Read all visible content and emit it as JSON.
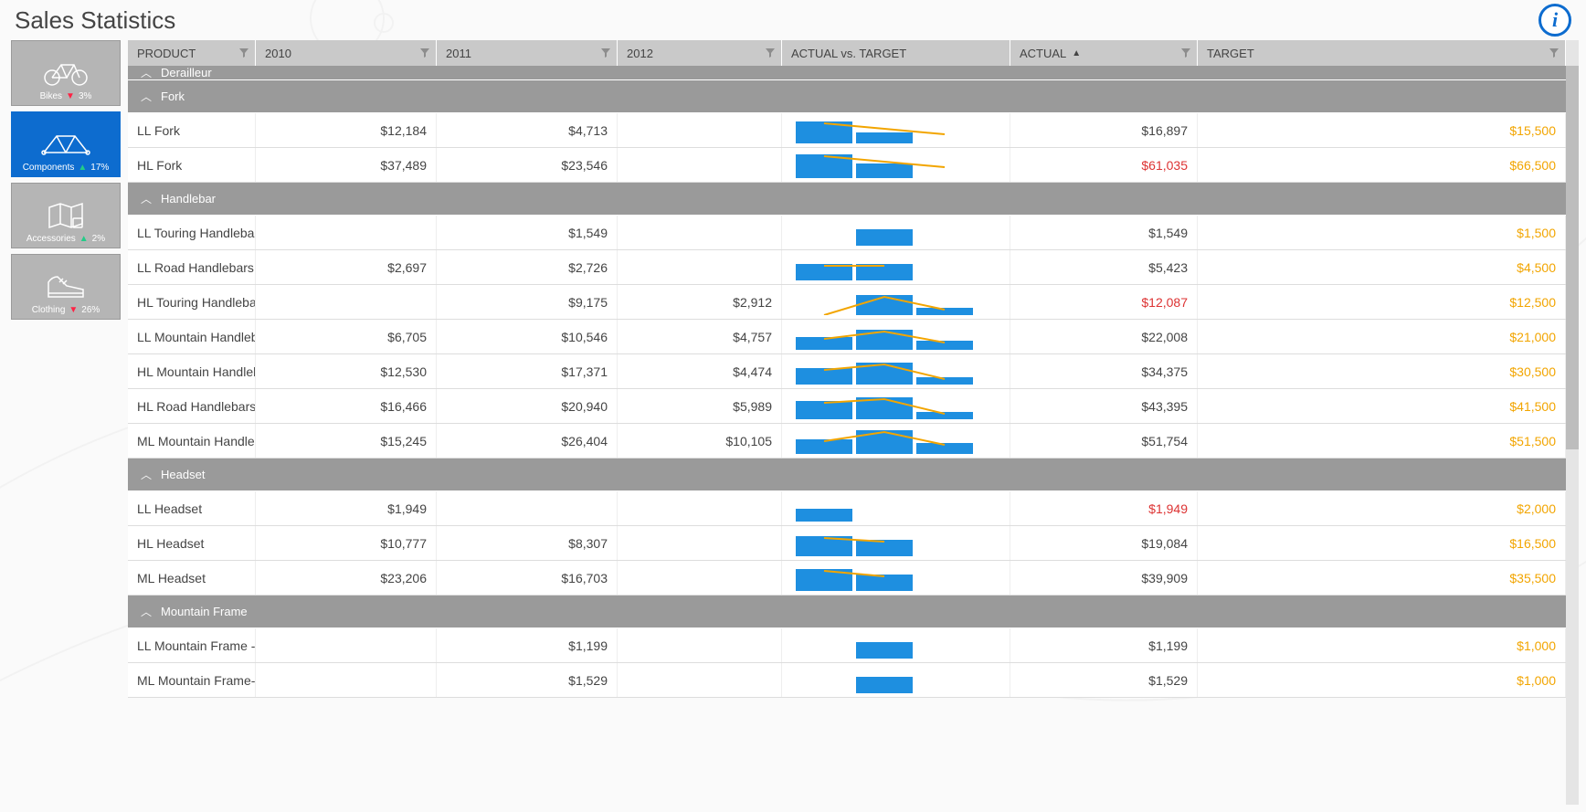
{
  "page": {
    "title": "Sales Statistics"
  },
  "sidebar": {
    "tiles": [
      {
        "label": "Bikes",
        "delta": "3%",
        "trend": "down",
        "icon": "bike",
        "active": false
      },
      {
        "label": "Components",
        "delta": "17%",
        "trend": "up",
        "icon": "frame",
        "active": true
      },
      {
        "label": "Accessories",
        "delta": "2%",
        "trend": "up",
        "icon": "map",
        "active": false
      },
      {
        "label": "Clothing",
        "delta": "26%",
        "trend": "down",
        "icon": "shoe",
        "active": false
      }
    ]
  },
  "columns": {
    "product": "PRODUCT",
    "y2010": "2010",
    "y2011": "2011",
    "y2012": "2012",
    "avt": "ACTUAL vs. TARGET",
    "actual": "ACTUAL",
    "target": "TARGET"
  },
  "groups": [
    {
      "name": "Derailleur",
      "collapsedHeader": true,
      "rows": []
    },
    {
      "name": "Fork",
      "rows": [
        {
          "product": "LL Fork",
          "y2010": "$12,184",
          "y2011": "$4,713",
          "y2012": "",
          "actual": "$16,897",
          "target": "$15,500",
          "spark": [
            24,
            12,
            0
          ],
          "line": [
            22,
            16,
            10
          ],
          "red": false
        },
        {
          "product": "HL Fork",
          "y2010": "$37,489",
          "y2011": "$23,546",
          "y2012": "",
          "actual": "$61,035",
          "target": "$66,500",
          "spark": [
            26,
            16,
            0
          ],
          "line": [
            24,
            18,
            12
          ],
          "red": true
        }
      ]
    },
    {
      "name": "Handlebar",
      "rows": [
        {
          "product": "LL Touring Handlebar",
          "y2010": "",
          "y2011": "$1,549",
          "y2012": "",
          "actual": "$1,549",
          "target": "$1,500",
          "spark": [
            0,
            18,
            0
          ],
          "line": [],
          "red": false
        },
        {
          "product": "LL Road Handlebars",
          "y2010": "$2,697",
          "y2011": "$2,726",
          "y2012": "",
          "actual": "$5,423",
          "target": "$4,500",
          "spark": [
            18,
            18,
            0
          ],
          "line": [
            16,
            16
          ],
          "red": false
        },
        {
          "product": "HL Touring Handlebar",
          "y2010": "",
          "y2011": "$9,175",
          "y2012": "$2,912",
          "actual": "$12,087",
          "target": "$12,500",
          "spark": [
            0,
            22,
            8
          ],
          "line": [
            0,
            20,
            6
          ],
          "red": true
        },
        {
          "product": "LL Mountain Handleb",
          "y2010": "$6,705",
          "y2011": "$10,546",
          "y2012": "$4,757",
          "actual": "$22,008",
          "target": "$21,000",
          "spark": [
            14,
            22,
            10
          ],
          "line": [
            12,
            20,
            8
          ],
          "red": false
        },
        {
          "product": "HL Mountain Handleb",
          "y2010": "$12,530",
          "y2011": "$17,371",
          "y2012": "$4,474",
          "actual": "$34,375",
          "target": "$30,500",
          "spark": [
            18,
            24,
            8
          ],
          "line": [
            16,
            22,
            6
          ],
          "red": false
        },
        {
          "product": "HL Road Handlebars",
          "y2010": "$16,466",
          "y2011": "$20,940",
          "y2012": "$5,989",
          "actual": "$43,395",
          "target": "$41,500",
          "spark": [
            20,
            24,
            8
          ],
          "line": [
            18,
            22,
            6
          ],
          "red": false
        },
        {
          "product": "ML Mountain Handle",
          "y2010": "$15,245",
          "y2011": "$26,404",
          "y2012": "$10,105",
          "actual": "$51,754",
          "target": "$51,500",
          "spark": [
            16,
            26,
            12
          ],
          "line": [
            14,
            24,
            10
          ],
          "red": false
        }
      ]
    },
    {
      "name": "Headset",
      "rows": [
        {
          "product": "LL Headset",
          "y2010": "$1,949",
          "y2011": "",
          "y2012": "",
          "actual": "$1,949",
          "target": "$2,000",
          "spark": [
            14,
            0,
            0
          ],
          "line": [],
          "red": true
        },
        {
          "product": "HL Headset",
          "y2010": "$10,777",
          "y2011": "$8,307",
          "y2012": "",
          "actual": "$19,084",
          "target": "$16,500",
          "spark": [
            22,
            18,
            0
          ],
          "line": [
            20,
            16
          ],
          "red": false
        },
        {
          "product": "ML Headset",
          "y2010": "$23,206",
          "y2011": "$16,703",
          "y2012": "",
          "actual": "$39,909",
          "target": "$35,500",
          "spark": [
            24,
            18,
            0
          ],
          "line": [
            22,
            16
          ],
          "red": false
        }
      ]
    },
    {
      "name": "Mountain Frame",
      "rows": [
        {
          "product": "LL Mountain Frame -",
          "y2010": "",
          "y2011": "$1,199",
          "y2012": "",
          "actual": "$1,199",
          "target": "$1,000",
          "spark": [
            0,
            18,
            0
          ],
          "line": [],
          "red": false
        },
        {
          "product": "ML Mountain Frame-",
          "y2010": "",
          "y2011": "$1,529",
          "y2012": "",
          "actual": "$1,529",
          "target": "$1,000",
          "spark": [
            0,
            18,
            0
          ],
          "line": [],
          "red": false
        }
      ]
    }
  ],
  "chart_data": {
    "type": "table",
    "title": "Sales Statistics — Components",
    "columns": [
      "Product",
      "2010",
      "2011",
      "2012",
      "Actual",
      "Target"
    ],
    "series": [
      {
        "name": "LL Fork",
        "values": [
          12184,
          4713,
          null,
          16897,
          15500
        ]
      },
      {
        "name": "HL Fork",
        "values": [
          37489,
          23546,
          null,
          61035,
          66500
        ]
      },
      {
        "name": "LL Touring Handlebar",
        "values": [
          null,
          1549,
          null,
          1549,
          1500
        ]
      },
      {
        "name": "LL Road Handlebars",
        "values": [
          2697,
          2726,
          null,
          5423,
          4500
        ]
      },
      {
        "name": "HL Touring Handlebar",
        "values": [
          null,
          9175,
          2912,
          12087,
          12500
        ]
      },
      {
        "name": "LL Mountain Handlebars",
        "values": [
          6705,
          10546,
          4757,
          22008,
          21000
        ]
      },
      {
        "name": "HL Mountain Handlebars",
        "values": [
          12530,
          17371,
          4474,
          34375,
          30500
        ]
      },
      {
        "name": "HL Road Handlebars",
        "values": [
          16466,
          20940,
          5989,
          43395,
          41500
        ]
      },
      {
        "name": "ML Mountain Handlebars",
        "values": [
          15245,
          26404,
          10105,
          51754,
          51500
        ]
      },
      {
        "name": "LL Headset",
        "values": [
          1949,
          null,
          null,
          1949,
          2000
        ]
      },
      {
        "name": "HL Headset",
        "values": [
          10777,
          8307,
          null,
          19084,
          16500
        ]
      },
      {
        "name": "ML Headset",
        "values": [
          23206,
          16703,
          null,
          39909,
          35500
        ]
      },
      {
        "name": "LL Mountain Frame",
        "values": [
          null,
          1199,
          null,
          1199,
          1000
        ]
      },
      {
        "name": "ML Mountain Frame",
        "values": [
          null,
          1529,
          null,
          1529,
          1000
        ]
      }
    ]
  }
}
